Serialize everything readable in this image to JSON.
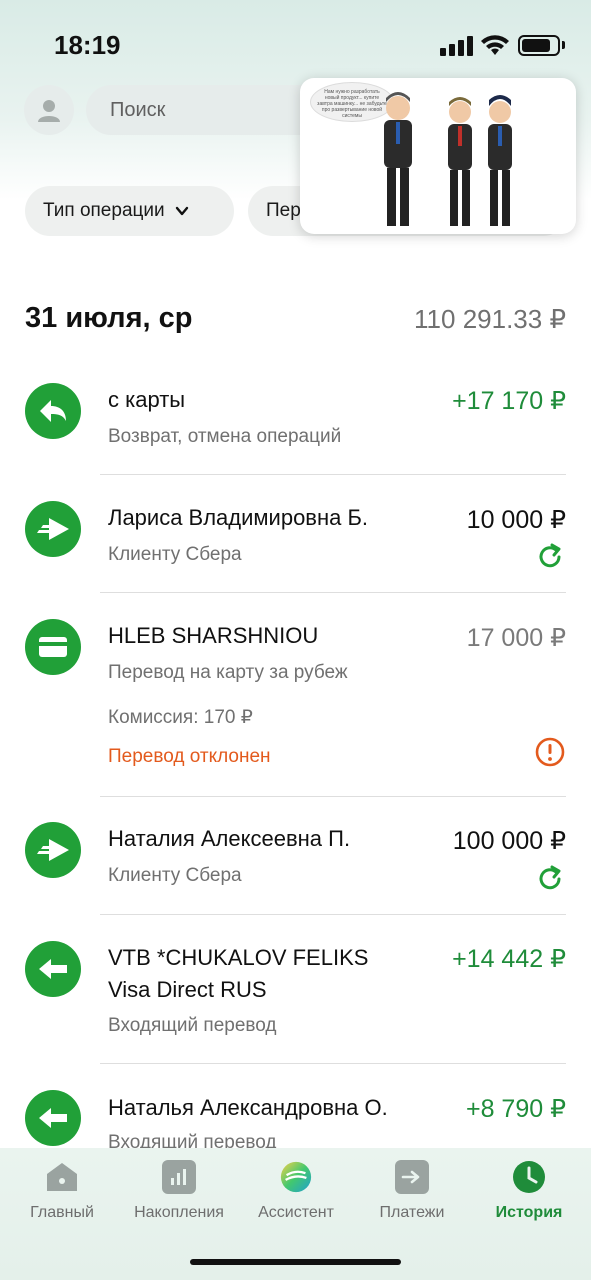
{
  "status_bar": {
    "time": "18:19"
  },
  "search": {
    "placeholder": "Поиск"
  },
  "filters": [
    {
      "label": "Тип операции"
    },
    {
      "label": "Пер"
    }
  ],
  "video_overlay": {
    "caption": "Нам нужно разработать новый продукт... купите завтра машинку... не забудьте про развертывание новой системы"
  },
  "history": {
    "date": "31 июля, ср",
    "day_total": "110 291.33 ₽",
    "transactions": [
      {
        "title": "с карты",
        "subtitle": "Возврат, отмена операций",
        "amount": "+17 170 ₽",
        "icon": "arrow-back-icon"
      },
      {
        "title": "Лариса Владимировна Б.",
        "subtitle": "Клиенту Сбера",
        "amount": "10 000 ₽",
        "icon": "transfer-out-icon"
      },
      {
        "title": "HLEB SHARSHNIOU",
        "subtitle": "Перевод на карту за рубеж",
        "commission": "Комиссия: 170 ₽",
        "status": "Перевод отклонен",
        "amount": "17 000 ₽",
        "icon": "card-icon"
      },
      {
        "title": "Наталия Алексеевна П.",
        "subtitle": "Клиенту Сбера",
        "amount": "100 000 ₽",
        "icon": "transfer-out-icon"
      },
      {
        "title_line1": "VTB *CHUKALOV FELIKS",
        "title_line2": "Visa Direct RUS",
        "subtitle": "Входящий перевод",
        "amount": "+14 442 ₽",
        "icon": "transfer-in-icon"
      },
      {
        "title": "Наталья Александровна О.",
        "subtitle": "Входящий перевод",
        "amount": "+8 790 ₽",
        "icon": "transfer-in-icon"
      }
    ]
  },
  "bottom_nav": [
    {
      "label": "Главный",
      "icon": "home-icon"
    },
    {
      "label": "Накопления",
      "icon": "savings-icon"
    },
    {
      "label": "Ассистент",
      "icon": "assistant-logo-icon"
    },
    {
      "label": "Платежи",
      "icon": "payments-icon"
    },
    {
      "label": "История",
      "icon": "history-icon",
      "active": true
    }
  ],
  "colors": {
    "accent": "#21a038",
    "positive": "#1f8c3a",
    "error": "#e35a1d"
  }
}
